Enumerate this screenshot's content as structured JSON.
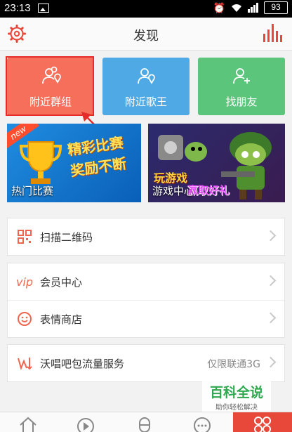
{
  "status_bar": {
    "time": "23:13",
    "battery": "93"
  },
  "header": {
    "title": "发现"
  },
  "tiles": [
    {
      "label": "附近群组",
      "color": "#f66f5a",
      "icon": "group-location-icon"
    },
    {
      "label": "附近歌王",
      "color": "#4ea9e5",
      "icon": "singer-location-icon"
    },
    {
      "label": "找朋友",
      "color": "#5bc57b",
      "icon": "add-friend-icon"
    }
  ],
  "banners": [
    {
      "caption": "热门比赛",
      "promo_text": "精彩比赛 奖励不断",
      "tag": "new"
    },
    {
      "caption": "游戏中心",
      "promo_text": "玩游戏",
      "promo_text2": "赢取好礼"
    }
  ],
  "menu_groups": [
    [
      {
        "label": "扫描二维码",
        "icon": "qr-code-icon"
      }
    ],
    [
      {
        "label": "会员中心",
        "icon": "vip-icon",
        "icon_text": "vip"
      },
      {
        "label": "表情商店",
        "icon": "smiley-icon"
      }
    ],
    [
      {
        "label": "沃唱吧包流量服务",
        "icon": "traffic-icon",
        "value": "仅限联通3G"
      }
    ]
  ],
  "watermark": {
    "title": "百科全说",
    "subtitle": "助你轻松解决"
  },
  "bottom_nav": [
    "home-icon",
    "play-icon",
    "microphone-icon",
    "chat-icon",
    "discover-icon"
  ],
  "colors": {
    "accent": "#e8483a",
    "highlight": "#e62b2b"
  }
}
